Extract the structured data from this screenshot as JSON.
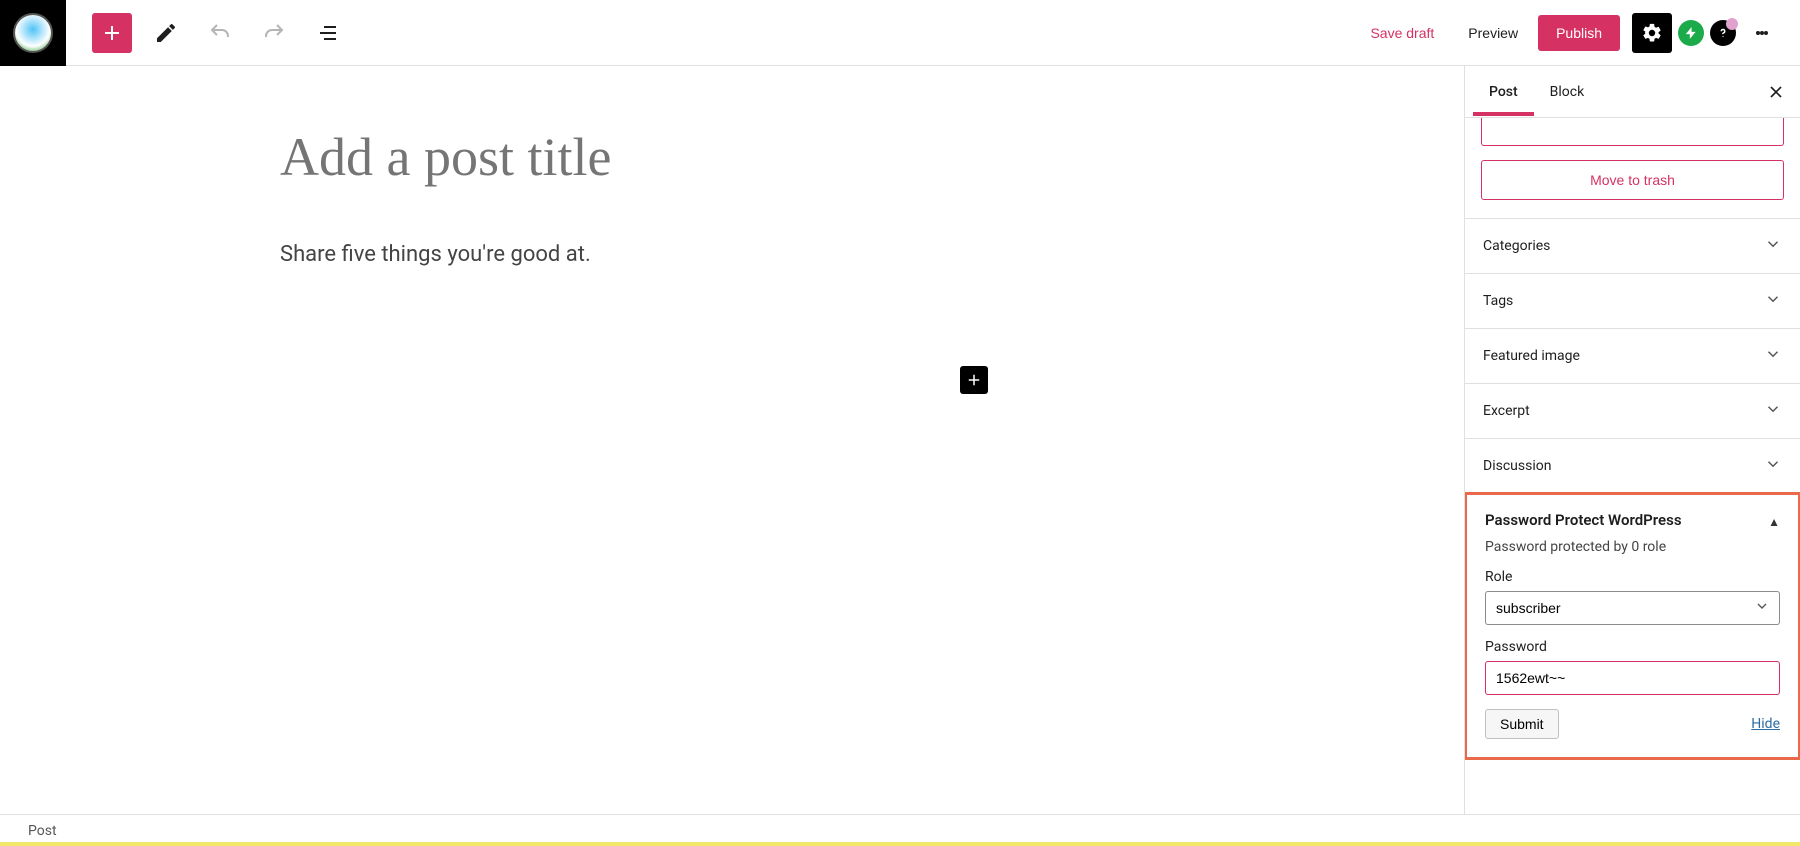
{
  "header": {
    "save_draft": "Save draft",
    "preview": "Preview",
    "publish": "Publish"
  },
  "icons": {
    "add_block": "plus-icon",
    "edit": "pencil-icon",
    "undo": "undo-icon",
    "redo": "redo-icon",
    "outline": "outline-icon",
    "settings": "gear-icon",
    "jetpack": "bolt-icon",
    "help": "question-icon",
    "more": "kebab-icon",
    "close": "x-icon",
    "chevron_down": "chevron-down-icon",
    "triangle_up": "triangle-up-icon"
  },
  "editor": {
    "title_placeholder": "Add a post title",
    "prompt": "Share five things you're good at."
  },
  "sidebar": {
    "tabs": {
      "post": "Post",
      "block": "Block"
    },
    "trash": "Move to trash",
    "panels": {
      "categories": "Categories",
      "tags": "Tags",
      "featured": "Featured image",
      "excerpt": "Excerpt",
      "discussion": "Discussion"
    },
    "plugin": {
      "title": "Password Protect WordPress",
      "subtitle": "Password protected by 0 role",
      "role_label": "Role",
      "role_value": "subscriber",
      "password_label": "Password",
      "password_value": "1562ewt~~",
      "submit": "Submit",
      "hide": "Hide"
    }
  },
  "footer": {
    "breadcrumb": "Post"
  },
  "colors": {
    "accent": "#d63163",
    "highlight_border": "#e96a4b"
  }
}
